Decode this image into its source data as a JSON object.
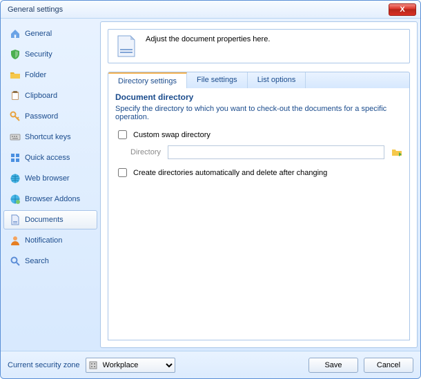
{
  "title": "General settings",
  "close_glyph": "X",
  "sidebar": {
    "items": [
      {
        "label": "General"
      },
      {
        "label": "Security"
      },
      {
        "label": "Folder"
      },
      {
        "label": "Clipboard"
      },
      {
        "label": "Password"
      },
      {
        "label": "Shortcut keys"
      },
      {
        "label": "Quick access"
      },
      {
        "label": "Web browser"
      },
      {
        "label": "Browser Addons"
      },
      {
        "label": "Documents"
      },
      {
        "label": "Notification"
      },
      {
        "label": "Search"
      }
    ],
    "selected_index": 9
  },
  "info_text": "Adjust the document properties here.",
  "tabs": {
    "items": [
      {
        "label": "Directory settings"
      },
      {
        "label": "File settings"
      },
      {
        "label": "List options"
      }
    ],
    "active_index": 0
  },
  "panel": {
    "section_title": "Document directory",
    "section_desc": "Specify the directory to which you want to check-out the documents for a specific operation.",
    "custom_swap_label": "Custom swap directory",
    "custom_swap_checked": false,
    "directory_label": "Directory",
    "directory_value": "",
    "create_dirs_label": "Create directories automatically and delete after changing",
    "create_dirs_checked": false
  },
  "footer": {
    "zone_label": "Current security zone",
    "zone_selected": "Workplace",
    "zone_options": [
      "Workplace"
    ],
    "save_label": "Save",
    "cancel_label": "Cancel"
  }
}
